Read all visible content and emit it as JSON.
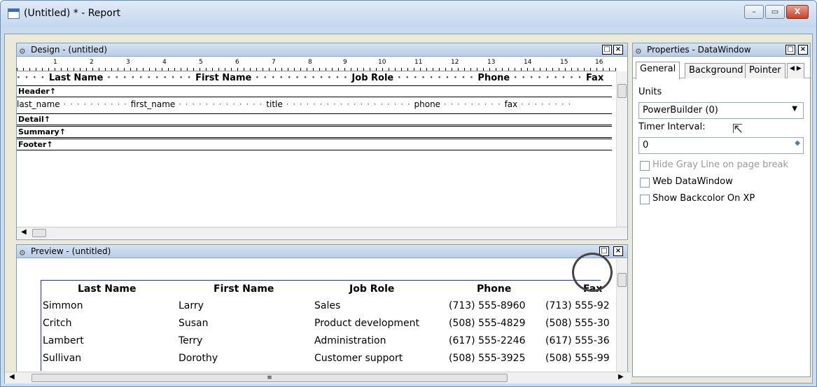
{
  "window": {
    "title": "(Untitled) * - Report",
    "minimize": "–",
    "maximize": "▭",
    "close": "X"
  },
  "design": {
    "title": "Design - (untitled)",
    "ruler": [
      "1",
      "2",
      "3",
      "4",
      "5",
      "6",
      "7",
      "8",
      "9",
      "10",
      "11",
      "12",
      "13",
      "14",
      "15",
      "16"
    ],
    "headers": [
      "Last Name",
      "First Name",
      "Job Role",
      "Phone",
      "Fax"
    ],
    "fields": [
      "last_name",
      "first_name",
      "title",
      "phone",
      "fax"
    ],
    "bands": [
      "Header↑",
      "Detail↑",
      "Summary↑",
      "Footer↑"
    ]
  },
  "preview": {
    "title": "Preview - (untitled)",
    "headers": [
      "Last Name",
      "First Name",
      "Job Role",
      "Phone",
      "Fax"
    ],
    "rows": [
      [
        "Simmon",
        "Larry",
        "Sales",
        "(713) 555-8960",
        "(713) 555-92"
      ],
      [
        "Critch",
        "Susan",
        "Product development",
        "(508) 555-4829",
        "(508) 555-30"
      ],
      [
        "Lambert",
        "Terry",
        "Administration",
        "(617) 555-2246",
        "(617) 555-36"
      ],
      [
        "Sullivan",
        "Dorothy",
        "Customer support",
        "(508) 555-3925",
        "(508) 555-99"
      ]
    ]
  },
  "properties": {
    "title": "Properties - DataWindow",
    "tabs": [
      "General",
      "Background",
      "Pointer"
    ],
    "units_label": "Units",
    "units_value": "PowerBuilder (0)",
    "timer_label": "Timer Interval:",
    "timer_value": "0",
    "checkboxes": [
      "Hide Gray Line on page break",
      "Web DataWindow",
      "Show Backcolor On XP"
    ]
  }
}
